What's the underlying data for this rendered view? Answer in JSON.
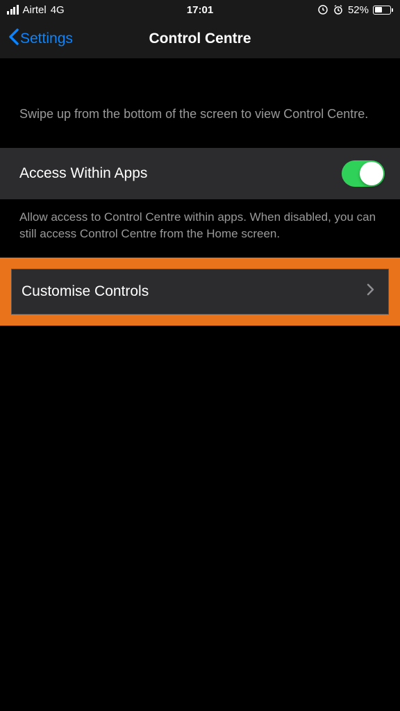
{
  "statusBar": {
    "carrier": "Airtel",
    "network": "4G",
    "time": "17:01",
    "battery": "52%"
  },
  "navBar": {
    "backLabel": "Settings",
    "title": "Control Centre"
  },
  "sections": {
    "introDescription": "Swipe up from the bottom of the screen to view Control Centre.",
    "accessWithinApps": {
      "label": "Access Within Apps",
      "enabled": true,
      "footer": "Allow access to Control Centre within apps. When disabled, you can still access Control Centre from the Home screen."
    },
    "customiseControls": {
      "label": "Customise Controls"
    }
  }
}
